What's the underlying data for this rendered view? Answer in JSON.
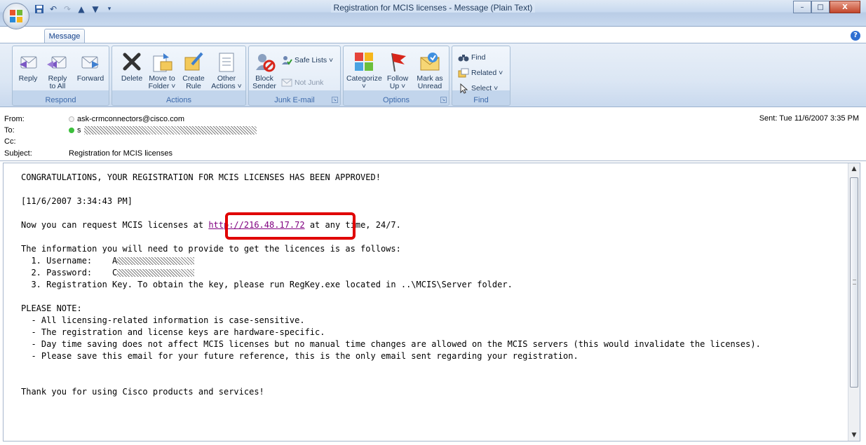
{
  "window": {
    "title": "Registration for MCIS licenses - Message (Plain Text)",
    "minimize_glyph": "–",
    "maximize_glyph": "□",
    "close_glyph": "X"
  },
  "ribbon": {
    "active_tab": "Message",
    "help": "?",
    "groups": {
      "respond": "Respond",
      "actions": "Actions",
      "junk": "Junk E-mail",
      "options": "Options",
      "find": "Find"
    },
    "buttons": {
      "reply": "Reply",
      "reply_all": "Reply\nto All",
      "forward": "Forward",
      "delete": "Delete",
      "move_to_folder": "Move to\nFolder ˅",
      "create_rule": "Create\nRule",
      "other_actions": "Other\nActions ˅",
      "block_sender": "Block\nSender",
      "safe_lists": "Safe Lists ˅",
      "not_junk": "Not Junk",
      "categorize": "Categorize\n˅",
      "follow_up": "Follow\nUp ˅",
      "mark_as_unread": "Mark as\nUnread",
      "find": "Find",
      "related": "Related ˅",
      "select": "Select ˅"
    }
  },
  "header": {
    "from_label": "From:",
    "from_value": "ask-crmconnectors@cisco.com",
    "to_label": "To:",
    "to_value_prefix": "s",
    "cc_label": "Cc:",
    "subject_label": "Subject:",
    "subject_value": "Registration for MCIS licenses",
    "sent_label": "Sent:",
    "sent_value": "Tue 11/6/2007 3:35 PM"
  },
  "body": {
    "line_congrats": "CONGRATULATIONS, YOUR REGISTRATION FOR MCIS LICENSES HAS BEEN APPROVED!",
    "line_timestamp": "[11/6/2007 3:34:43 PM]",
    "line_request_prefix": "Now you can request MCIS licenses at ",
    "link": "http://216.48.17.72",
    "line_request_suffix": " at any time, 24/7.",
    "line_info": "The information you will need to provide to get the licences is as follows:",
    "item_username_label": "  1. Username:    ",
    "item_username_value_prefix": "A",
    "item_password_label": "  2. Password:    ",
    "item_password_value_prefix": "C",
    "item_key": "  3. Registration Key. To obtain the key, please run RegKey.exe located in ..\\MCIS\\Server folder.",
    "note_heading": "PLEASE NOTE:",
    "note_1": "  - All licensing-related information is case-sensitive.",
    "note_2": "  - The registration and license keys are hardware-specific.",
    "note_3": "  - Day time saving does not affect MCIS licenses but no manual time changes are allowed on the MCIS servers (this would invalidate the licenses).",
    "note_4": "  - Please save this email for your future reference, this is the only email sent regarding your registration.",
    "thanks": "Thank you for using Cisco products and services!"
  },
  "colors": {
    "link": "#800080",
    "highlight": "#e00000",
    "ribbon_label": "#3e6aaa"
  }
}
